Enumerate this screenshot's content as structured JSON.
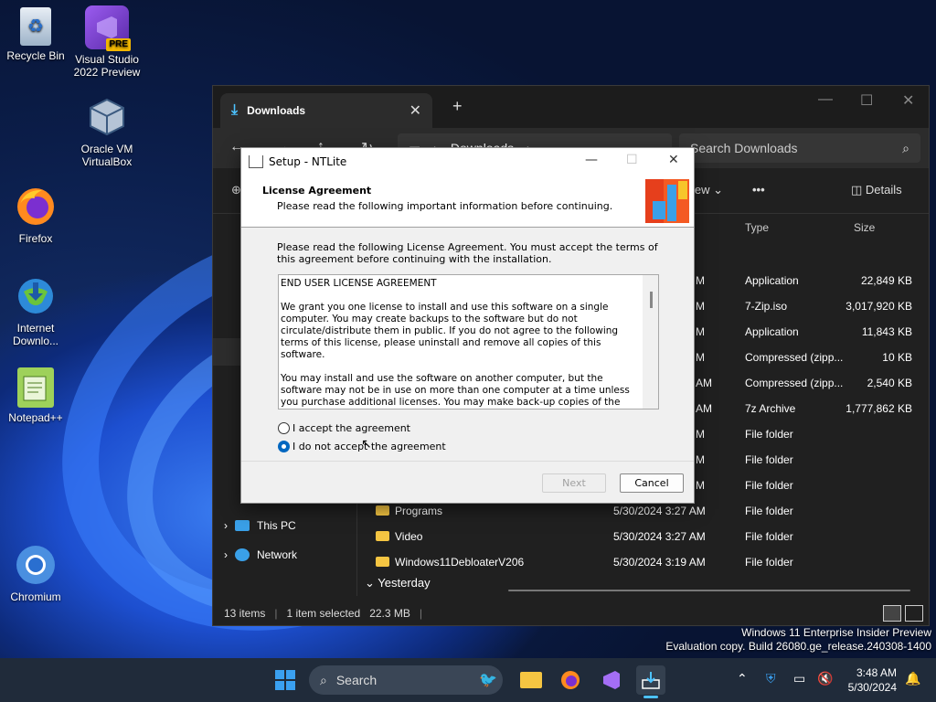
{
  "desktop": {
    "icons": [
      {
        "label": "Recycle Bin"
      },
      {
        "label": "Visual Studio 2022 Preview",
        "badge": "PRE"
      },
      {
        "label": "Oracle VM VirtualBox"
      },
      {
        "label": "Firefox"
      },
      {
        "label": "Internet Downlo..."
      },
      {
        "label": "Notepad++"
      },
      {
        "label": "Chromium"
      }
    ]
  },
  "explorer": {
    "tab_title": "Downloads",
    "address": "Downloads",
    "search_placeholder": "Search Downloads",
    "view_label": "iew",
    "details_label": "Details",
    "columns": {
      "type": "Type",
      "size": "Size"
    },
    "rows": [
      {
        "name": "",
        "date": "M",
        "type": "Application",
        "size": "22,849 KB"
      },
      {
        "name": "",
        "date": "M",
        "type": "7-Zip.iso",
        "size": "3,017,920 KB"
      },
      {
        "name": "",
        "date": "M",
        "type": "Application",
        "size": "11,843 KB"
      },
      {
        "name": "",
        "date": "M",
        "type": "Compressed (zipp...",
        "size": "10 KB"
      },
      {
        "name": "",
        "date": "AM",
        "type": "Compressed (zipp...",
        "size": "2,540 KB"
      },
      {
        "name": "",
        "date": "AM",
        "type": "7z Archive",
        "size": "1,777,862 KB"
      },
      {
        "name": "",
        "date": "M",
        "type": "File folder",
        "size": ""
      },
      {
        "name": "",
        "date": "M",
        "type": "File folder",
        "size": ""
      },
      {
        "name": "",
        "date": "M",
        "type": "File folder",
        "size": ""
      },
      {
        "name": "Programs",
        "date": "5/30/2024 3:27 AM",
        "type": "File folder",
        "size": ""
      },
      {
        "name": "Video",
        "date": "5/30/2024 3:27 AM",
        "type": "File folder",
        "size": ""
      },
      {
        "name": "Windows11DebloaterV206",
        "date": "5/30/2024 3:19 AM",
        "type": "File folder",
        "size": ""
      }
    ],
    "group_yesterday": "Yesterday",
    "sidebar": {
      "this_pc": "This PC",
      "network": "Network"
    },
    "status": {
      "items": "13 items",
      "selected": "1 item selected",
      "size": "22.3 MB"
    }
  },
  "dialog": {
    "title": "Setup - NTLite",
    "heading": "License Agreement",
    "subheading": "Please read the following important information before continuing.",
    "intro": "Please read the following License Agreement. You must accept the terms of this agreement before continuing with the installation.",
    "license_text": "END USER LICENSE AGREEMENT\n\nWe grant you one license to install and use this software on a single computer. You may create backups to the software but do not circulate/distribute them in public. If you do not agree to the following terms of this license, please uninstall and remove all copies of this software.\n\nYou may install and use the software on another computer, but the software may not be in use on more than one computer at a time unless you purchase additional licenses. You may make back-up copies of the software for archival purposes. License cannot be transferred or resold to another party, unless agreement was",
    "accept_label": "I accept the agreement",
    "decline_label": "I do not accept the agreement",
    "selected": "decline",
    "next_label": "Next",
    "cancel_label": "Cancel"
  },
  "watermark": {
    "line1": "Windows 11 Enterprise Insider Preview",
    "line2": "Evaluation copy. Build 26080.ge_release.240308-1400"
  },
  "taskbar": {
    "search_label": "Search",
    "time": "3:48 AM",
    "date": "5/30/2024"
  },
  "colors": {
    "accent": "#0067c0",
    "folder": "#f5c542",
    "download_icon": "#4cc2ff"
  }
}
